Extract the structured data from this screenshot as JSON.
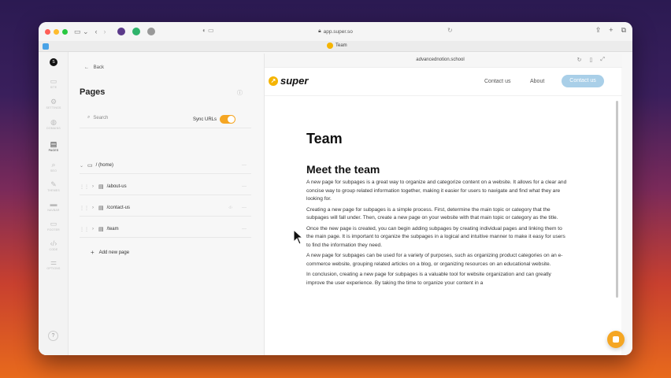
{
  "browser": {
    "url": "app.super.so",
    "tab_title": "Team"
  },
  "leftnav": {
    "items": [
      {
        "label": "SITE",
        "icon": "monitor-icon"
      },
      {
        "label": "SETTINGS",
        "icon": "gear-icon"
      },
      {
        "label": "DOMAINS",
        "icon": "globe-icon"
      },
      {
        "label": "PAGES",
        "icon": "document-icon",
        "active": true
      },
      {
        "label": "SEO",
        "icon": "magnifier-icon"
      },
      {
        "label": "THEMES",
        "icon": "brush-icon"
      },
      {
        "label": "NAVBAR",
        "icon": "navbar-icon"
      },
      {
        "label": "FOOTER",
        "icon": "footer-icon"
      },
      {
        "label": "CODE",
        "icon": "code-icon"
      },
      {
        "label": "OPTIONS",
        "icon": "sliders-icon"
      }
    ]
  },
  "panel": {
    "back_label": "Back",
    "title": "Pages",
    "search_placeholder": "Search",
    "sync_label": "Sync URLs",
    "pages": [
      {
        "path": "/ (home)"
      },
      {
        "path": "/about-us"
      },
      {
        "path": "/contact-us"
      },
      {
        "path": "/team"
      }
    ],
    "add_page_label": "Add new page"
  },
  "preview": {
    "domain": "advancednotion.school",
    "logo_text": "super",
    "nav_links": [
      "Contact us",
      "About"
    ],
    "cta_label": "Contact us",
    "page_title": "Team",
    "section_title": "Meet the team",
    "paragraphs": [
      "A new page for subpages is a great way to organize and categorize content on a website. It allows for a clear and concise way to group related information together, making it easier for users to navigate and find what they are looking for.",
      "Creating a new page for subpages is a simple process. First, determine the main topic or category that the subpages will fall under. Then, create a new page on your website with that main topic or category as the title.",
      "Once the new page is created, you can begin adding subpages by creating individual pages and linking them to the main page. It is important to organize the subpages in a logical and intuitive manner to make it easy for users to find the information they need.",
      "A new page for subpages can be used for a variety of purposes, such as organizing product categories on an e-commerce website, grouping related articles on a blog, or organizing resources on an educational website.",
      "In conclusion, creating a new page for subpages is a valuable tool for website organization and can greatly improve the user experience. By taking the time to organize your content in a"
    ]
  },
  "colors": {
    "accent": "#f5a623",
    "cta": "#a9cfe8",
    "brand_badge": "#f5b400"
  }
}
